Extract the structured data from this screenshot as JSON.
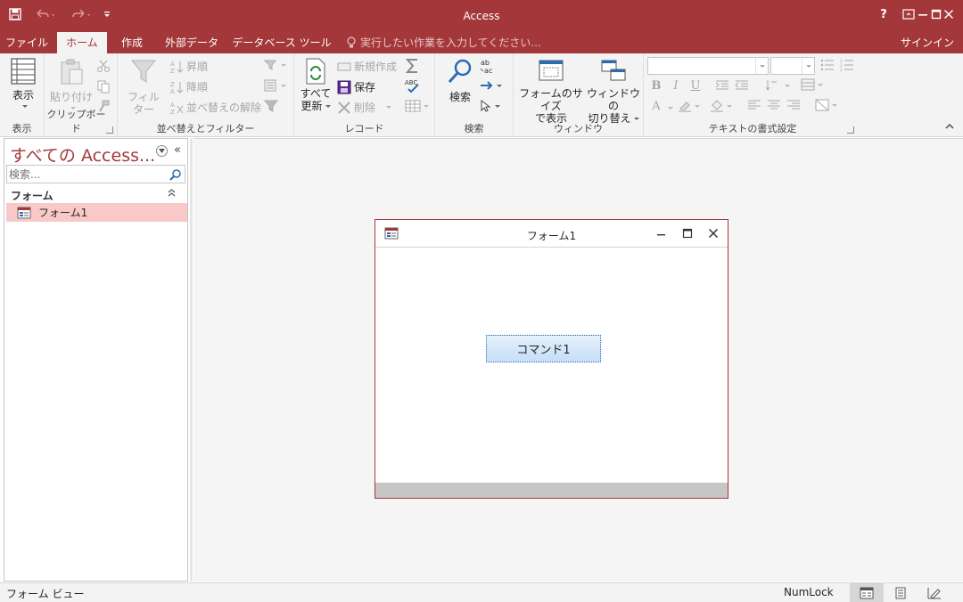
{
  "app": {
    "title": "Access",
    "help": "?"
  },
  "tabs": {
    "file": "ファイル",
    "home": "ホーム",
    "create": "作成",
    "external": "外部データ",
    "dbtools": "データベース ツール",
    "tellme": "実行したい作業を入力してください...",
    "signin": "サインイン"
  },
  "ribbon": {
    "view": {
      "label": "表示",
      "group": "表示"
    },
    "clipboard": {
      "paste": "貼り付け",
      "group": "クリップボード"
    },
    "sort": {
      "filter": "フィルター",
      "asc": "昇順",
      "desc": "降順",
      "clear": "並べ替えの解除",
      "group": "並べ替えとフィルター"
    },
    "records": {
      "refresh_1": "すべて",
      "refresh_2": "更新",
      "new": "新規作成",
      "save": "保存",
      "delete": "削除",
      "group": "レコード"
    },
    "find": {
      "find": "検索",
      "group": "検索"
    },
    "window": {
      "size_1": "フォームのサイズ",
      "size_2": "で表示",
      "switch_1": "ウィンドウの",
      "switch_2": "切り替え",
      "group": "ウィンドウ"
    },
    "text": {
      "group": "テキストの書式設定",
      "bold": "B",
      "italic": "I",
      "underline": "U",
      "fontcolor": "A"
    }
  },
  "nav": {
    "title": "すべての Access...",
    "search_placeholder": "検索...",
    "section": "フォーム",
    "items": [
      {
        "label": "フォーム1"
      }
    ]
  },
  "form": {
    "title": "フォーム1",
    "button_label": "コマンド1"
  },
  "status": {
    "left": "フォーム ビュー",
    "numlock": "NumLock"
  },
  "colors": {
    "accent": "#a4373a",
    "selected_item": "#f9c8c9",
    "button_fill": "#c5def7"
  }
}
